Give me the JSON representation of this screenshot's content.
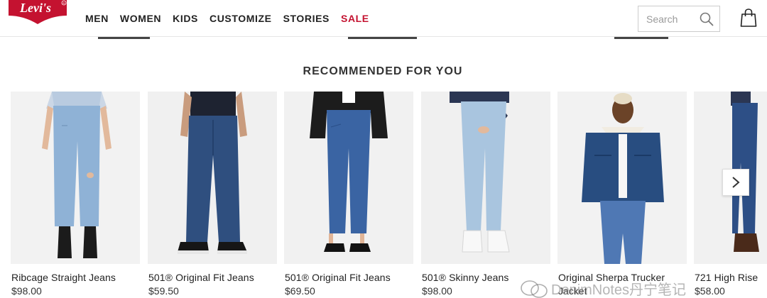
{
  "brand": {
    "logo_text": "Levi's",
    "accent_color": "#c41230"
  },
  "nav": {
    "items": [
      {
        "label": "MEN"
      },
      {
        "label": "WOMEN"
      },
      {
        "label": "KIDS"
      },
      {
        "label": "CUSTOMIZE"
      },
      {
        "label": "STORIES"
      },
      {
        "label": "SALE"
      }
    ]
  },
  "search": {
    "placeholder": "Search",
    "icon": "search-icon"
  },
  "cart": {
    "icon": "shopping-bag-icon"
  },
  "section": {
    "title": "RECOMMENDED FOR YOU"
  },
  "products": [
    {
      "name": "Ribcage Straight Jeans",
      "price": "$98.00"
    },
    {
      "name": "501® Original Fit Jeans",
      "price": "$59.50"
    },
    {
      "name": "501® Original Fit Jeans",
      "price": "$69.50"
    },
    {
      "name": "501® Skinny Jeans",
      "price": "$98.00"
    },
    {
      "name": "Original Sherpa Trucker",
      "price": "Jacket"
    },
    {
      "name": "721 High Rise",
      "price": "$58.00"
    }
  ],
  "carousel": {
    "next_icon": "chevron-right-icon"
  },
  "watermark": {
    "text": "DenimNotes丹宁笔记"
  }
}
